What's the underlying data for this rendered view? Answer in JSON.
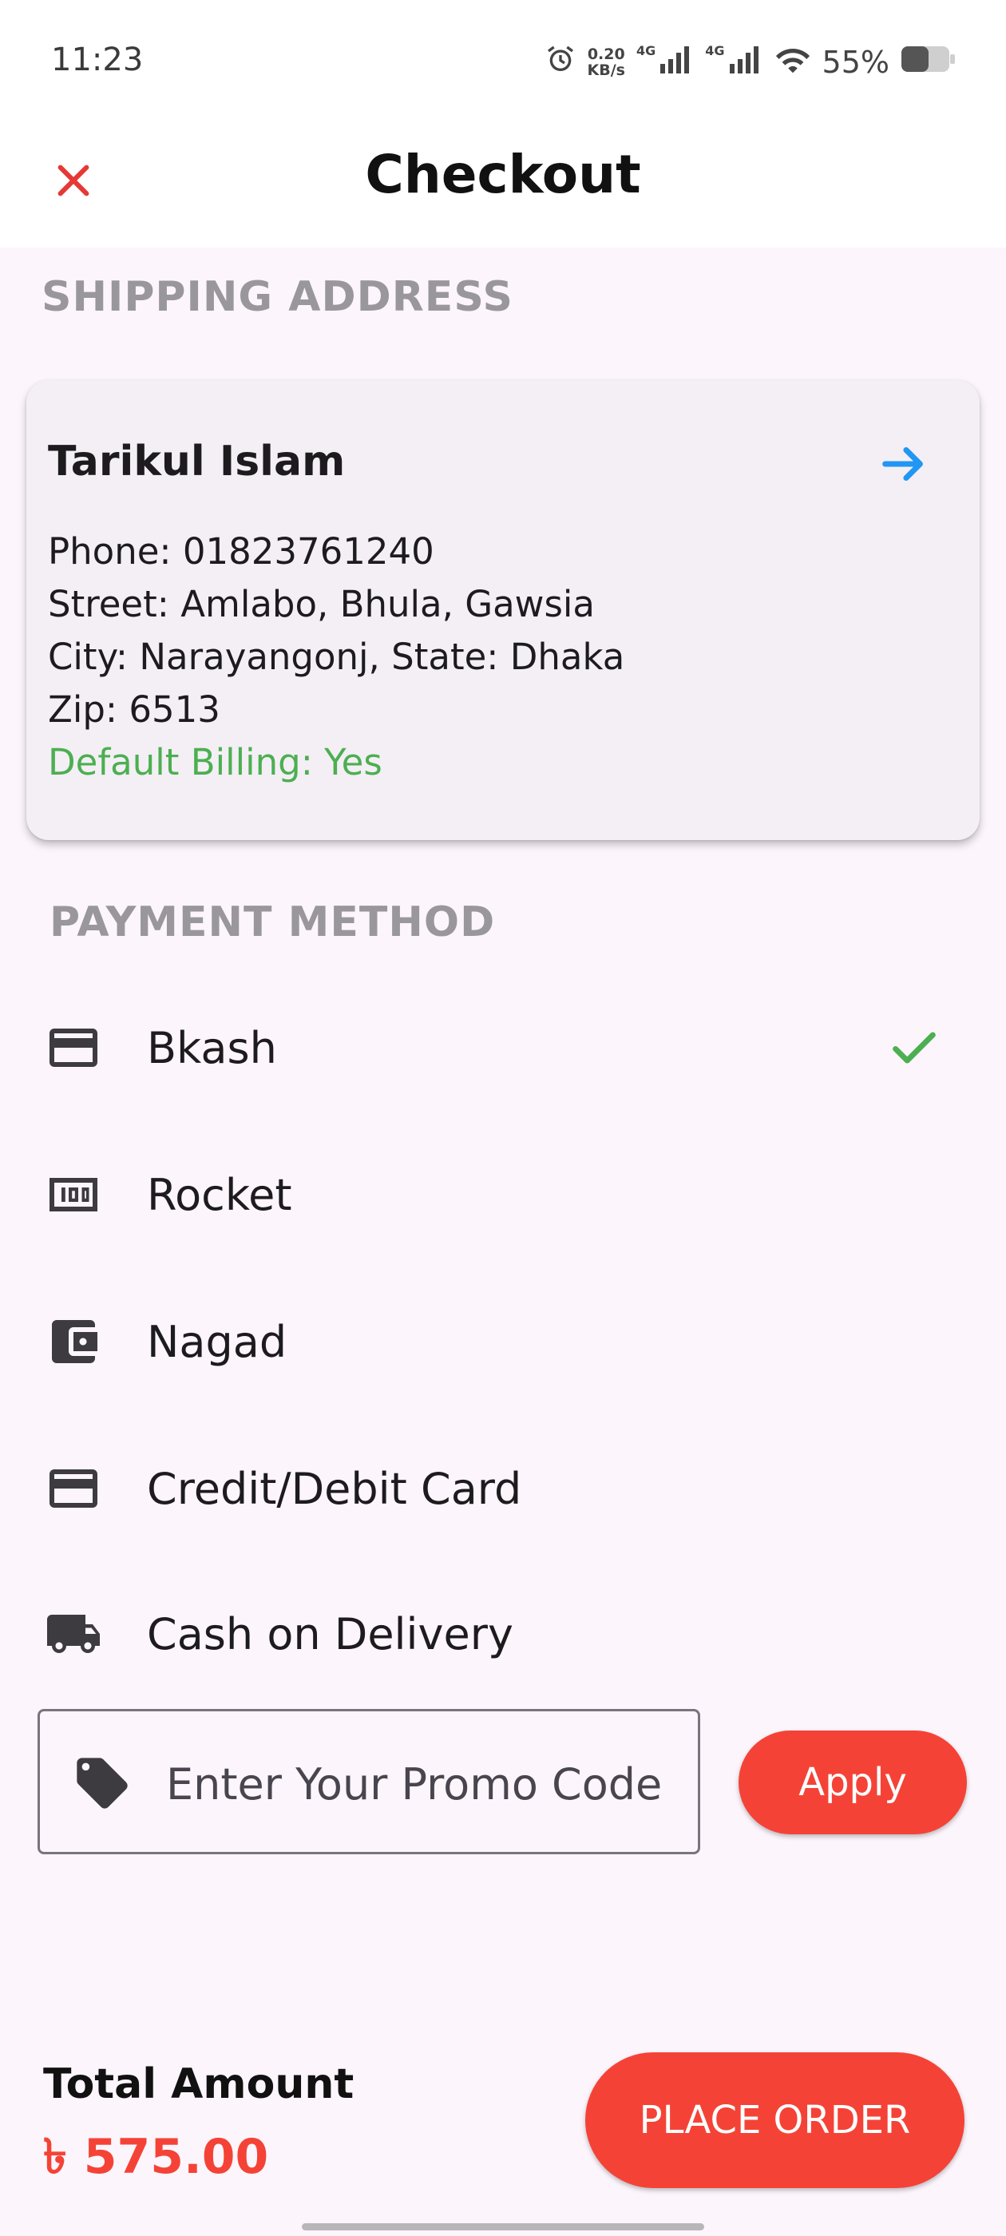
{
  "status_bar": {
    "time": "11:23",
    "net_speed_value": "0.20",
    "net_speed_unit": "KB/s",
    "signal1_label": "4G",
    "signal2_label": "4G",
    "battery_percent": "55%",
    "icons": [
      "alarm-icon",
      "signal-icon",
      "signal-icon",
      "wifi-icon",
      "battery-icon"
    ]
  },
  "app_bar": {
    "title": "Checkout",
    "close_icon": "close-icon",
    "close_color": "#e53935"
  },
  "shipping": {
    "section_title": "SHIPPING ADDRESS",
    "name": "Tarikul Islam",
    "phone": "Phone: 01823761240",
    "street": "Street: Amlabo, Bhula, Gawsia",
    "city_state": "City: Narayangonj, State: Dhaka",
    "zip": "Zip: 6513",
    "default_billing": "Default Billing: Yes",
    "arrow_icon": "arrow-right-icon",
    "arrow_color": "#2196f3",
    "default_color": "#4caf50"
  },
  "payment": {
    "section_title": "PAYMENT METHOD",
    "methods": [
      {
        "label": "Bkash",
        "icon": "credit-card-icon",
        "selected": true
      },
      {
        "label": "Rocket",
        "icon": "money-icon",
        "selected": false
      },
      {
        "label": "Nagad",
        "icon": "wallet-icon",
        "selected": false
      },
      {
        "label": "Credit/Debit Card",
        "icon": "credit-card-icon",
        "selected": false
      },
      {
        "label": "Cash on Delivery",
        "icon": "truck-icon",
        "selected": false
      }
    ],
    "check_color": "#4caf50"
  },
  "promo": {
    "placeholder": "Enter Your Promo Code",
    "value": "",
    "icon": "tag-icon",
    "apply_label": "Apply"
  },
  "footer": {
    "total_label": "Total Amount",
    "total_value": "৳ 575.00",
    "place_order_label": "PLACE ORDER",
    "accent_color": "#f44336"
  }
}
